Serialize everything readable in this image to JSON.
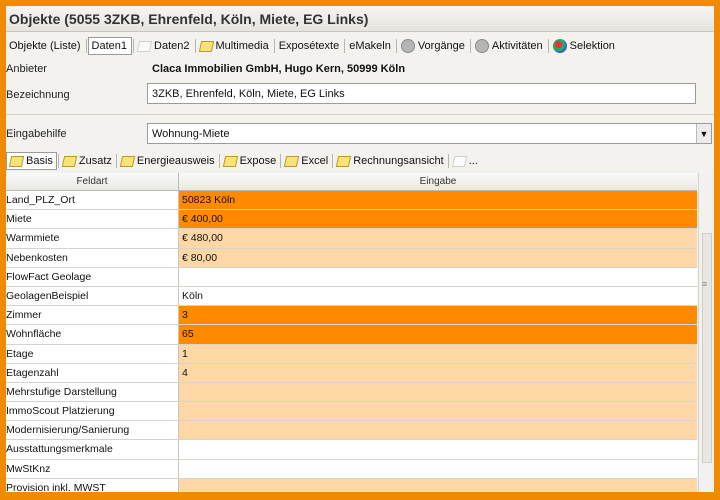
{
  "window": {
    "title": "Objekte (5055 3ZKB, Ehrenfeld, Köln, Miete, EG Links)"
  },
  "toptabs": [
    {
      "label": "Objekte (Liste)",
      "icon": "",
      "active": false
    },
    {
      "label": "Daten1",
      "icon": "",
      "active": true
    },
    {
      "label": "Daten2",
      "icon": "ghost-note-icon",
      "active": false
    },
    {
      "label": "Multimedia",
      "icon": "note-icon",
      "active": false
    },
    {
      "label": "Exposétexte",
      "icon": "",
      "active": false
    },
    {
      "label": "eMakeln",
      "icon": "",
      "active": false
    },
    {
      "label": "Vorgänge",
      "icon": "gear-icon",
      "active": false
    },
    {
      "label": "Aktivitäten",
      "icon": "gear-icon",
      "active": false
    },
    {
      "label": "Selektion",
      "icon": "selection-icon",
      "active": false
    }
  ],
  "form": {
    "anbieter_label": "Anbieter",
    "anbieter_value": "Claca Immobilien GmbH, Hugo Kern, 50999 Köln",
    "bezeichnung_label": "Bezeichnung",
    "bezeichnung_value": "3ZKB, Ehrenfeld, Köln, Miete, EG Links",
    "eingabehilfe_label": "Eingabehilfe",
    "eingabehilfe_value": "Wohnung-Miete"
  },
  "subtabs": [
    {
      "label": "Basis",
      "active": true
    },
    {
      "label": "Zusatz",
      "active": false
    },
    {
      "label": "Energieausweis",
      "active": false
    },
    {
      "label": "Expose",
      "active": false
    },
    {
      "label": "Excel",
      "active": false
    },
    {
      "label": "Rechnungsansicht",
      "active": false
    },
    {
      "label": "...",
      "active": false
    }
  ],
  "grid": {
    "col1": "Feldart",
    "col2": "Eingabe",
    "rows": [
      {
        "field": "Land_PLZ_Ort",
        "value": "50823 Köln",
        "style": "strong"
      },
      {
        "field": "Miete",
        "value": "€ 400,00",
        "style": "strong"
      },
      {
        "field": "Warmmiete",
        "value": "€ 480,00",
        "style": "light"
      },
      {
        "field": "Nebenkosten",
        "value": "€ 80,00",
        "style": "light"
      },
      {
        "field": "FlowFact Geolage",
        "value": "",
        "style": "none"
      },
      {
        "field": "GeolagenBeispiel",
        "value": "Köln",
        "style": "none"
      },
      {
        "field": "Zimmer",
        "value": "3",
        "style": "strong"
      },
      {
        "field": "Wohnfläche",
        "value": "65",
        "style": "strong"
      },
      {
        "field": "Etage",
        "value": "1",
        "style": "light"
      },
      {
        "field": "Etagenzahl",
        "value": "4",
        "style": "light"
      },
      {
        "field": "Mehrstufige Darstellung",
        "value": "",
        "style": "light"
      },
      {
        "field": "ImmoScout Platzierung",
        "value": "",
        "style": "light"
      },
      {
        "field": "Modernisierung/Sanierung",
        "value": "",
        "style": "light"
      },
      {
        "field": "Ausstattungsmerkmale",
        "value": "",
        "style": "none"
      },
      {
        "field": "MwStKnz",
        "value": "",
        "style": "none"
      },
      {
        "field": "Provision inkl. MWST",
        "value": "",
        "style": "light"
      }
    ]
  },
  "colors": {
    "frame": "#f08a00",
    "strong": "#ff8a00",
    "light": "#fdd7a6",
    "none": "#ffffff"
  }
}
